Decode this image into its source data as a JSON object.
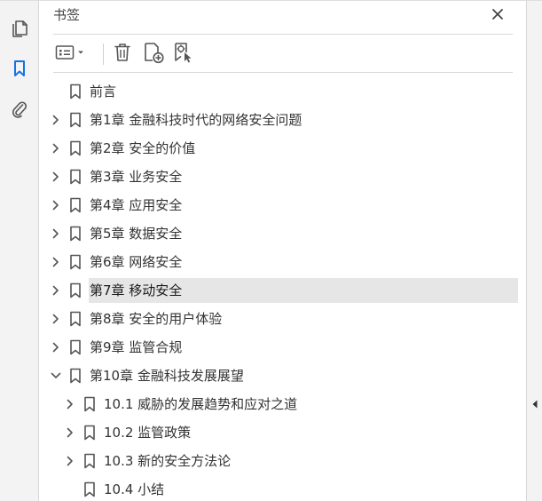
{
  "rail": {
    "icons": [
      "pages-icon",
      "bookmark-icon",
      "paperclip-icon"
    ],
    "accent": "#1473e6"
  },
  "panel": {
    "title": "书签"
  },
  "toolbar": {
    "icons": [
      "options-menu-icon",
      "delete-icon",
      "new-bookmark-icon",
      "bookmark-from-selection-icon"
    ]
  },
  "bookmarks": [
    {
      "label": "前言",
      "level": 0,
      "expander": "none",
      "selected": false
    },
    {
      "label": "第1章 金融科技时代的网络安全问题",
      "level": 0,
      "expander": "collapsed",
      "selected": false
    },
    {
      "label": "第2章 安全的价值",
      "level": 0,
      "expander": "collapsed",
      "selected": false
    },
    {
      "label": "第3章 业务安全",
      "level": 0,
      "expander": "collapsed",
      "selected": false
    },
    {
      "label": "第4章 应用安全",
      "level": 0,
      "expander": "collapsed",
      "selected": false
    },
    {
      "label": "第5章 数据安全",
      "level": 0,
      "expander": "collapsed",
      "selected": false
    },
    {
      "label": "第6章 网络安全",
      "level": 0,
      "expander": "collapsed",
      "selected": false
    },
    {
      "label": "第7章 移动安全",
      "level": 0,
      "expander": "collapsed",
      "selected": true
    },
    {
      "label": "第8章 安全的用户体验",
      "level": 0,
      "expander": "collapsed",
      "selected": false
    },
    {
      "label": "第9章 监管合规",
      "level": 0,
      "expander": "collapsed",
      "selected": false
    },
    {
      "label": "第10章 金融科技发展展望",
      "level": 0,
      "expander": "expanded",
      "selected": false
    },
    {
      "label": "10.1 威胁的发展趋势和应对之道",
      "level": 1,
      "expander": "collapsed",
      "selected": false
    },
    {
      "label": "10.2 监管政策",
      "level": 1,
      "expander": "collapsed",
      "selected": false
    },
    {
      "label": "10.3 新的安全方法论",
      "level": 1,
      "expander": "collapsed",
      "selected": false
    },
    {
      "label": "10.4 小结",
      "level": 1,
      "expander": "none",
      "selected": false
    }
  ]
}
